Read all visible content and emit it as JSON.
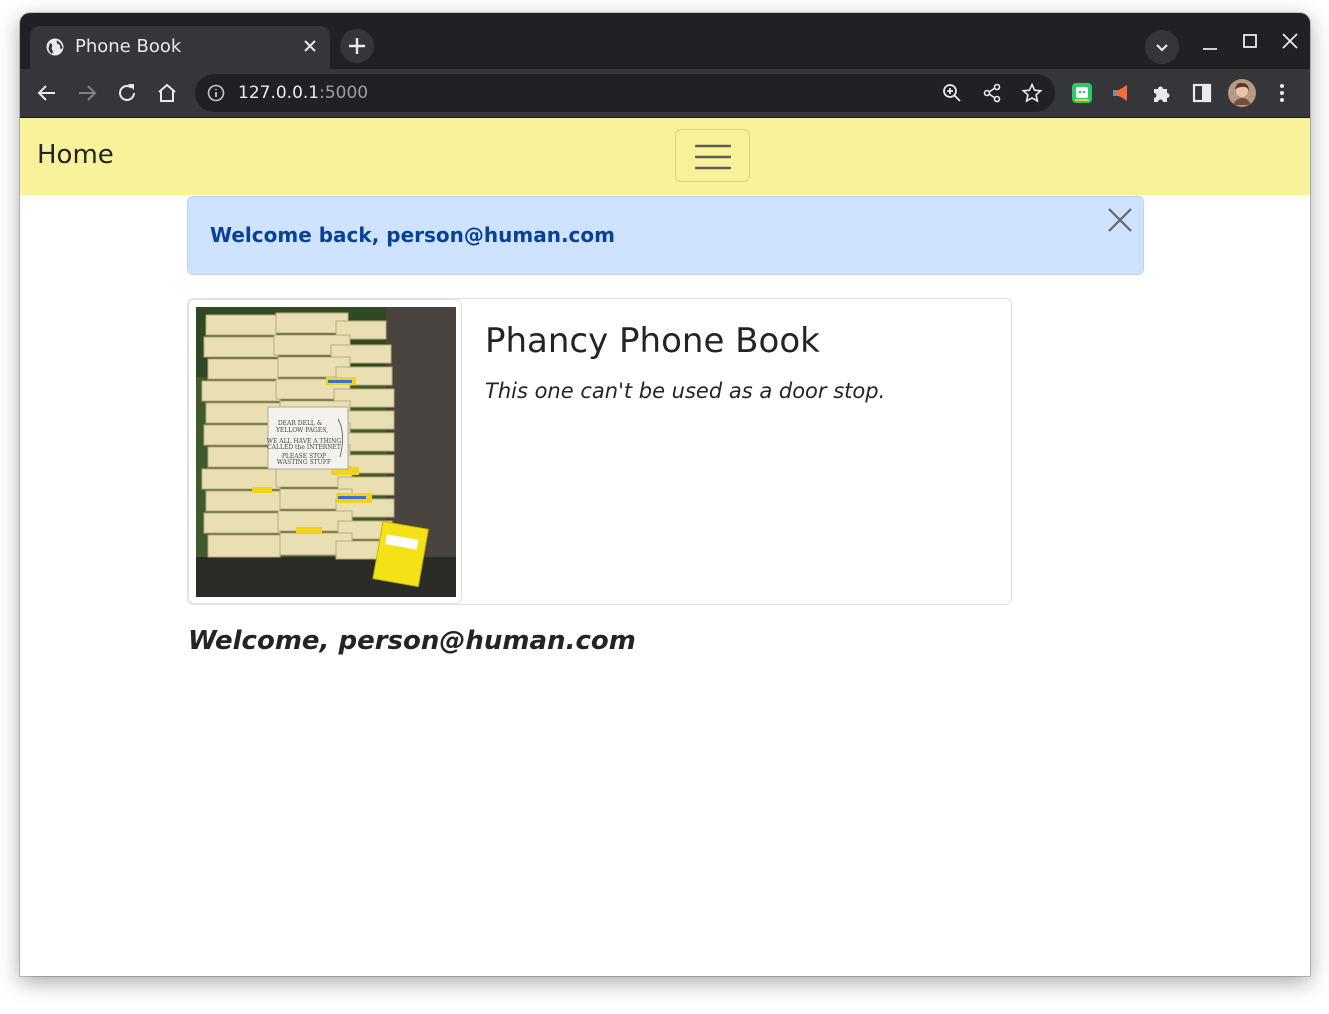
{
  "browser": {
    "tab_title": "Phone Book",
    "url_host": "127.0.0.1",
    "url_port": ":5000"
  },
  "navbar": {
    "brand": "Home",
    "background_color": "#f8f29a"
  },
  "alert": {
    "message": "Welcome back, person@human.com",
    "type": "info"
  },
  "card": {
    "image_sign_lines": [
      "DEAR DELL &",
      "YELLOW PAGES,",
      "WE ALL HAVE A THING",
      "CALLED the INTERNET",
      "PLEASE STOP",
      "WASTING STUFF"
    ],
    "title": "Phancy Phone Book",
    "text": "This one can't be used as a door stop."
  },
  "welcome": "Welcome, person@human.com",
  "icons": [
    "globe-icon",
    "close-icon",
    "plus-icon",
    "chevron-down-icon",
    "minimize-icon",
    "maximize-icon",
    "back-icon",
    "forward-icon",
    "reload-icon",
    "home-icon",
    "info-icon",
    "zoom-icon",
    "share-icon",
    "star-icon",
    "extension-green-icon",
    "extension-megaphone-icon",
    "puzzle-icon",
    "sidebar-icon",
    "avatar",
    "menu-icon",
    "hamburger-icon"
  ]
}
